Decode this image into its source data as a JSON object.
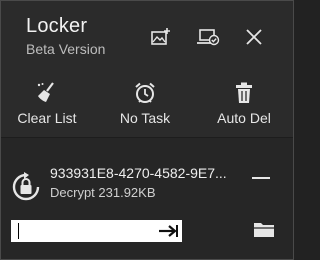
{
  "header": {
    "title": "Locker",
    "subtitle": "Beta Version",
    "buttons": [
      {
        "icon": "add-image-icon"
      },
      {
        "icon": "laptop-check-icon"
      },
      {
        "icon": "close-icon"
      }
    ]
  },
  "toolbar": {
    "clear_list": {
      "label": "Clear List",
      "icon": "broom-icon"
    },
    "no_task": {
      "label": "No Task",
      "icon": "alarm-clock-icon"
    },
    "auto_del": {
      "label": "Auto Del",
      "icon": "trash-icon"
    }
  },
  "task": {
    "name": "933931E8-4270-4582-9E7...",
    "status": "Decrypt 231.92KB",
    "password_value": "",
    "icons": {
      "lock": "lock-refresh-icon",
      "remove": "minus-icon",
      "submit": "arrow-right-icon",
      "browse": "folder-icon"
    }
  },
  "colors": {
    "background": "#262626",
    "header": "#2b2b2b",
    "text": "#e8e8e8",
    "input": "#ffffff"
  }
}
